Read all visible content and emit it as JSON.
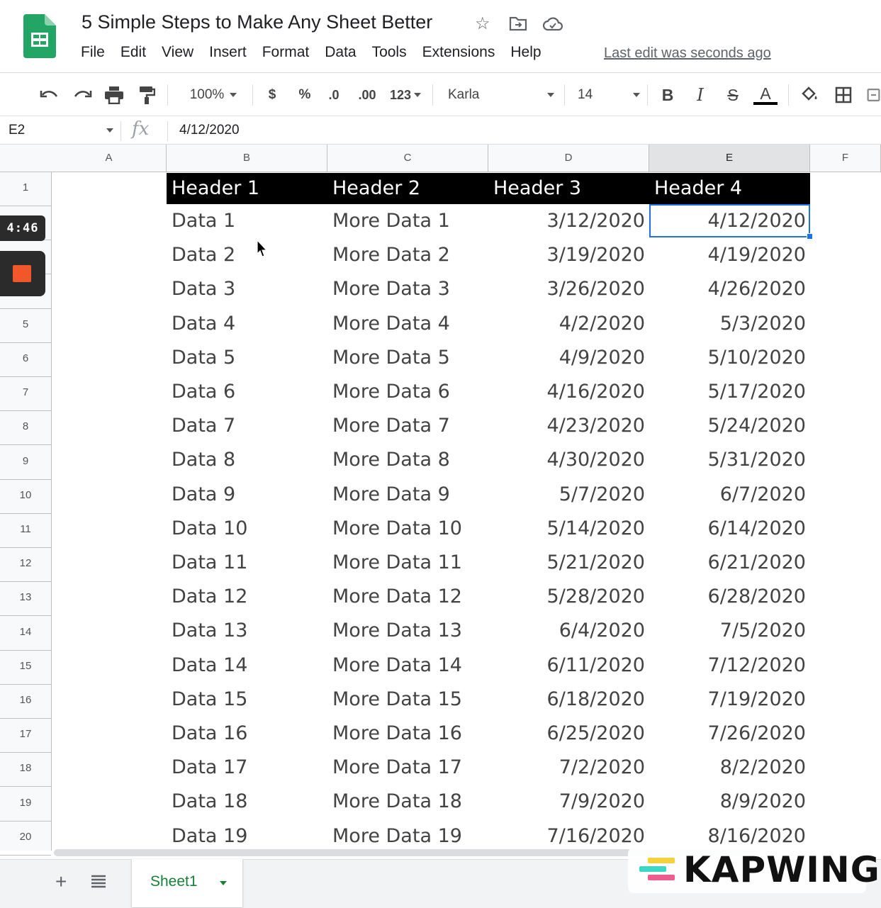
{
  "app": {
    "doc_title": "5 Simple Steps to Make Any Sheet Better",
    "menu": [
      "File",
      "Edit",
      "View",
      "Insert",
      "Format",
      "Data",
      "Tools",
      "Extensions",
      "Help"
    ],
    "last_edit": "Last edit was seconds ago",
    "title_icons": [
      "star-icon",
      "move-to-folder-icon",
      "cloud-status-icon"
    ]
  },
  "toolbar": {
    "zoom": "100%",
    "currency": "$",
    "percent": "%",
    "decrease_decimal": ".0",
    "increase_decimal": ".00",
    "more_formats": "123",
    "font": "Karla",
    "font_size": "14",
    "bold": "B",
    "italic": "I",
    "strikethrough": "S",
    "text_color": "A"
  },
  "formula_bar": {
    "name_box": "E2",
    "fx": "fx",
    "value": "4/12/2020"
  },
  "columns": [
    "A",
    "B",
    "C",
    "D",
    "E",
    "F"
  ],
  "selected_column": "E",
  "row_numbers": [
    "1",
    "",
    "",
    "",
    "5",
    "6",
    "7",
    "8",
    "9",
    "10",
    "11",
    "12",
    "13",
    "14",
    "15",
    "16",
    "17",
    "18",
    "19",
    "20"
  ],
  "table": {
    "headers": [
      "Header 1",
      "Header 2",
      "Header 3",
      "Header 4"
    ],
    "rows": [
      [
        "Data 1",
        "More Data 1",
        "3/12/2020",
        "4/12/2020"
      ],
      [
        "Data 2",
        "More Data 2",
        "3/19/2020",
        "4/19/2020"
      ],
      [
        "Data 3",
        "More Data 3",
        "3/26/2020",
        "4/26/2020"
      ],
      [
        "Data 4",
        "More Data 4",
        "4/2/2020",
        "5/3/2020"
      ],
      [
        "Data 5",
        "More Data 5",
        "4/9/2020",
        "5/10/2020"
      ],
      [
        "Data 6",
        "More Data 6",
        "4/16/2020",
        "5/17/2020"
      ],
      [
        "Data 7",
        "More Data 7",
        "4/23/2020",
        "5/24/2020"
      ],
      [
        "Data 8",
        "More Data 8",
        "4/30/2020",
        "5/31/2020"
      ],
      [
        "Data 9",
        "More Data 9",
        "5/7/2020",
        "6/7/2020"
      ],
      [
        "Data 10",
        "More Data 10",
        "5/14/2020",
        "6/14/2020"
      ],
      [
        "Data 11",
        "More Data 11",
        "5/21/2020",
        "6/21/2020"
      ],
      [
        "Data 12",
        "More Data 12",
        "5/28/2020",
        "6/28/2020"
      ],
      [
        "Data 13",
        "More Data 13",
        "6/4/2020",
        "7/5/2020"
      ],
      [
        "Data 14",
        "More Data 14",
        "6/11/2020",
        "7/12/2020"
      ],
      [
        "Data 15",
        "More Data 15",
        "6/18/2020",
        "7/19/2020"
      ],
      [
        "Data 16",
        "More Data 16",
        "6/25/2020",
        "7/26/2020"
      ],
      [
        "Data 17",
        "More Data 17",
        "7/2/2020",
        "8/2/2020"
      ],
      [
        "Data 18",
        "More Data 18",
        "7/9/2020",
        "8/9/2020"
      ],
      [
        "Data 19",
        "More Data 19",
        "7/16/2020",
        "8/16/2020"
      ]
    ]
  },
  "sheet_tabs": [
    "Sheet1"
  ],
  "overlay": {
    "timer": "4:46",
    "watermark": "KAPWING"
  },
  "colors": {
    "header_bg": "#000000",
    "selection": "#1a73e8",
    "sheets_green": "#188038",
    "stop_red": "#f2562b"
  }
}
